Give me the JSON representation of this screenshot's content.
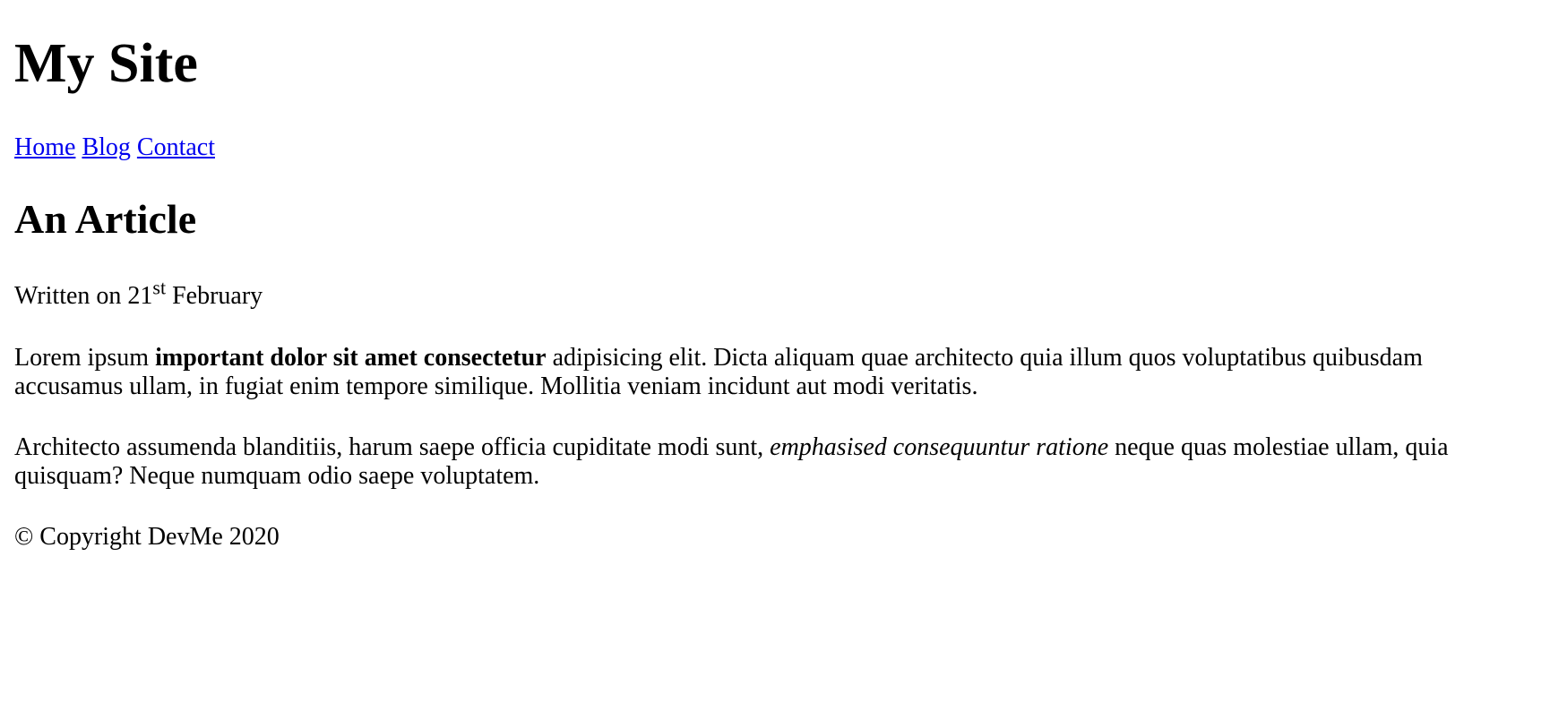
{
  "header": {
    "site_title": "My Site",
    "nav": [
      {
        "label": "Home"
      },
      {
        "label": "Blog"
      },
      {
        "label": "Contact"
      }
    ]
  },
  "article": {
    "title": "An Article",
    "date_prefix": "Written on 21",
    "date_suffix": "st",
    "date_month": " February",
    "paragraph1": {
      "start": "Lorem ipsum ",
      "strong": "important dolor sit amet consectetur",
      "end": " adipisicing elit. Dicta aliquam quae architecto quia illum quos voluptatibus quibusdam accusamus ullam, in fugiat enim tempore similique. Mollitia veniam incidunt aut modi veritatis."
    },
    "paragraph2": {
      "start": "Architecto assumenda blanditiis, harum saepe officia cupiditate modi sunt, ",
      "em": "emphasised consequuntur ratione",
      "end": " neque quas molestiae ullam, quia quisquam? Neque numquam odio saepe voluptatem."
    }
  },
  "footer": {
    "copyright": "© Copyright DevMe 2020"
  },
  "colors": {
    "link": "#0000ee",
    "text": "#000000",
    "background": "#ffffff"
  }
}
